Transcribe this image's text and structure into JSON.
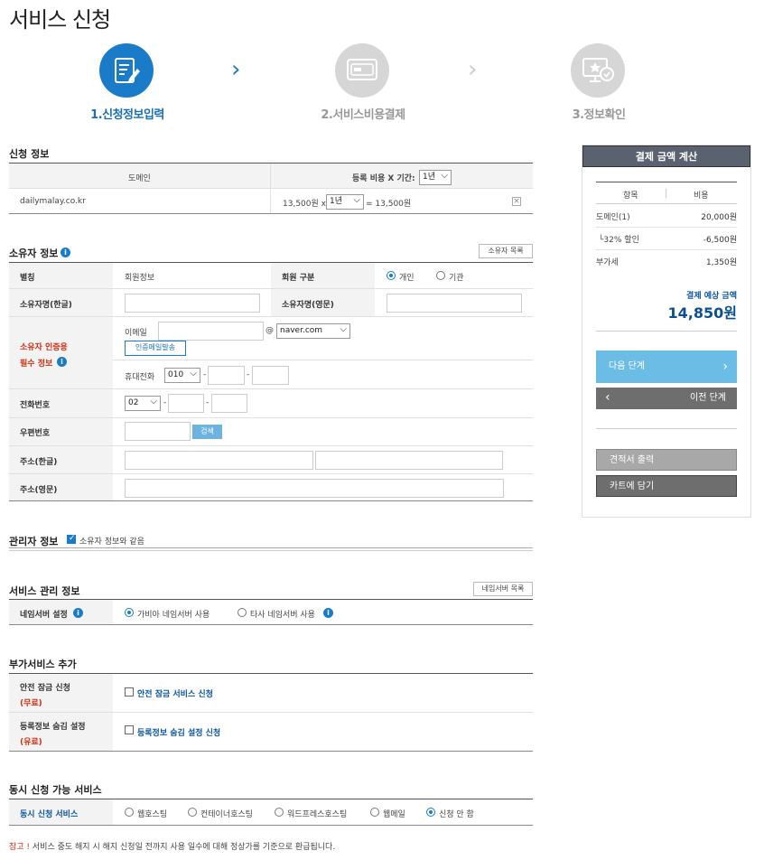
{
  "page": {
    "title": "서비스 신청"
  },
  "steps": [
    {
      "label": "1.신청정보입력",
      "active": true
    },
    {
      "label": "2.서비스비용결제",
      "active": false
    },
    {
      "label": "3.정보확인",
      "active": false
    }
  ],
  "application": {
    "title": "신청 정보",
    "col_domain": "도메인",
    "col_cost": "등록 비용 X 기간:",
    "period_header": "1년",
    "domain": "dailymalay.co.kr",
    "price": "13,500원 x",
    "period": "1년",
    "total": "= 13,500원",
    "remove_icon": "×"
  },
  "owner": {
    "title": "소유자 정보",
    "list_button": "소유자 목록",
    "alias_label": "별칭",
    "alias_value": "회원정보",
    "member_type_label": "회원 구분",
    "type_personal": "개인",
    "type_org": "기관",
    "name_ko_label": "소유자명(한글)",
    "name_en_label": "소유자명(영문)",
    "auth_label_1": "소유자 인증용",
    "auth_label_2": "필수 정보",
    "email_label": "이메일",
    "email_at": "@",
    "email_domain": "naver.com",
    "send_mail_button": "인증메일발송",
    "mobile_label": "휴대전화",
    "mobile_prefix": "010",
    "phone_label": "전화번호",
    "phone_prefix": "02",
    "zip_label": "우편번호",
    "zip_search": "검색",
    "addr_ko_label": "주소(한글)",
    "addr_en_label": "주소(영문)",
    "dash": "-"
  },
  "admin": {
    "title": "관리자 정보",
    "same_as_owner": "소유자 정보와 같음"
  },
  "service_mgmt": {
    "title": "서비스 관리 정보",
    "ns_list_button": "네임서버 목록",
    "ns_label": "네임서버 설정",
    "ns_gabia": "가비아 네임서버 사용",
    "ns_other": "타사 네임서버 사용"
  },
  "addons": {
    "title": "부가서비스 추가",
    "lock_label": "안전 잠금 신청",
    "lock_note": "(무료)",
    "lock_option": "안전 잠금 서비스 신청",
    "hide_label": "등록정보 숨김 설정",
    "hide_note": "(유료)",
    "hide_option": "등록정보 숨김 설정 신청"
  },
  "simultaneous": {
    "title": "동시 신청 가능 서비스",
    "label": "동시 신청 서비스",
    "options": [
      "웹호스팅",
      "컨테이너호스팅",
      "워드프레스호스팅",
      "웹메일",
      "신청 안 함"
    ],
    "selected_index": 4
  },
  "notice": {
    "prefix": "참고 !",
    "text": "서비스 중도 해지 시 해지 신청일 전까지 사용 일수에 대해 정상가를 기준으로 환급됩니다."
  },
  "sidebar": {
    "title": "결제 금액 계산",
    "col_item": "항목",
    "col_cost": "비용",
    "rows": [
      {
        "label": "도메인(1)",
        "value": "20,000원"
      },
      {
        "label": "└32% 할인",
        "value": "-6,500원"
      },
      {
        "label": "부가세",
        "value": "1,350원"
      }
    ],
    "estimate_label": "결제 예상 금액",
    "estimate_value": "14,850원",
    "next_button": "다음 단계",
    "prev_button": "이전 단계",
    "quote_button": "견적서 출력",
    "cart_button": "카트에 담기"
  },
  "colors": {
    "accent": "#1a7cc9",
    "next": "#6cbde6",
    "dark_button": "#6e6e6e",
    "discount": "#d03010"
  }
}
